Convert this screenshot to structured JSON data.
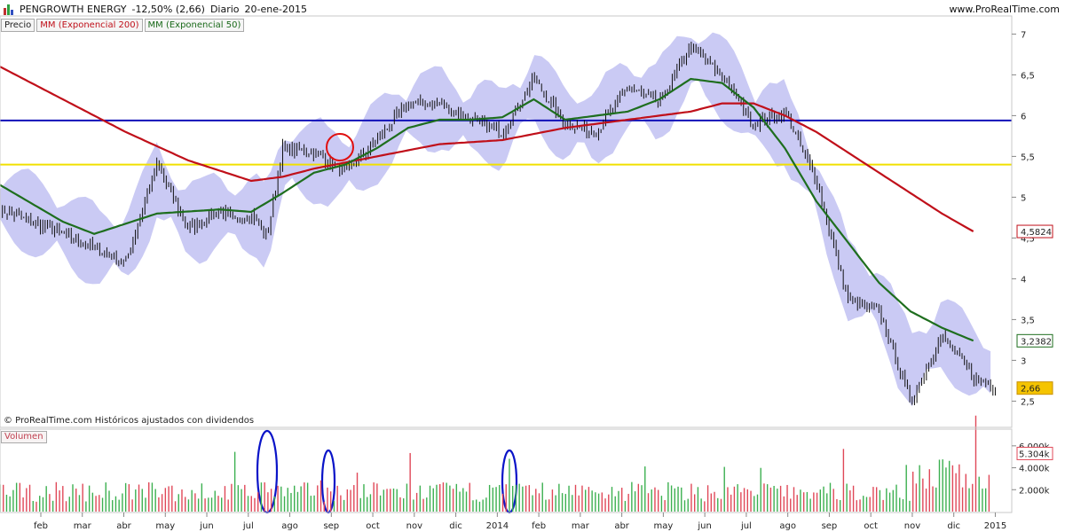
{
  "header": {
    "symbol": "PENGROWTH ENERGY",
    "change": "-12,50% (2,66)",
    "period": "Diario",
    "date": "20-ene-2015",
    "site": "www.ProRealTime.com"
  },
  "legend": {
    "price": "Precio",
    "ma200": "MM (Exponencial 200)",
    "ma50": "MM (Exponencial 50)"
  },
  "copyright": "© ProRealTime.com  Históricos ajustados con dividendos",
  "volume_label": "Volumen",
  "colors": {
    "ma200": "#c0101a",
    "ma50": "#1e6e1e",
    "band": "#b8b8f0",
    "blue_line": "#1010b8",
    "yellow_line": "#f0e000",
    "vol_up": "#3cb050",
    "vol_down": "#e04858",
    "highlight_circle_red": "#e01010",
    "highlight_ellipse_blue": "#0a14c8"
  },
  "price_labels": {
    "ma200": "4,5824",
    "ma50": "3,2382",
    "last": "2,66",
    "volume_last": "5.304k"
  },
  "chart_data": {
    "type": "line",
    "price_axis": {
      "ticks": [
        "7",
        "6,5",
        "6",
        "5,5",
        "5",
        "4,5",
        "4",
        "3,5",
        "3",
        "2,5"
      ],
      "values": [
        7,
        6.5,
        6,
        5.5,
        5,
        4.5,
        4,
        3.5,
        3,
        2.5
      ],
      "range": [
        2.2,
        7.2
      ]
    },
    "volume_axis": {
      "ticks": [
        "6.000k",
        "4.000k",
        "2.000k"
      ],
      "values": [
        6000,
        4000,
        2000
      ],
      "range": [
        0,
        7200
      ]
    },
    "x_ticks": [
      "feb",
      "mar",
      "abr",
      "may",
      "jun",
      "jul",
      "ago",
      "sep",
      "oct",
      "nov",
      "dic",
      "2014",
      "feb",
      "mar",
      "abr",
      "may",
      "jun",
      "jul",
      "ago",
      "sep",
      "oct",
      "nov",
      "dic",
      "2015"
    ],
    "horizontal_lines": [
      {
        "name": "resistance",
        "value": 5.94
      },
      {
        "name": "support",
        "value": 5.4
      }
    ],
    "price_series": {
      "name": "Precio",
      "t": [
        0,
        2,
        4,
        5,
        6,
        7,
        7.5,
        8,
        8.5,
        9,
        10,
        11,
        12,
        13,
        14,
        15,
        16,
        17,
        18,
        19,
        20,
        21,
        22,
        23,
        24,
        25,
        26,
        27,
        28,
        29,
        30,
        31,
        31.7
      ],
      "values": [
        4.85,
        4.55,
        4.2,
        5.4,
        4.6,
        4.85,
        4.7,
        4.8,
        4.5,
        5.6,
        5.55,
        5.3,
        5.7,
        6.15,
        6.15,
        5.95,
        5.8,
        6.45,
        5.9,
        5.8,
        6.35,
        6.15,
        6.85,
        6.5,
        5.9,
        6.05,
        5.2,
        3.75,
        3.6,
        2.5,
        3.3,
        2.8,
        2.66
      ]
    },
    "ma50_series": {
      "name": "MM (Exponencial 50)",
      "t": [
        0,
        2,
        3,
        5,
        7,
        8,
        9,
        10,
        11,
        12,
        13,
        14,
        15,
        16,
        17,
        18,
        19,
        20,
        21,
        22,
        23,
        24,
        25,
        26,
        27,
        28,
        29,
        30,
        31
      ],
      "values": [
        5.15,
        4.7,
        4.55,
        4.8,
        4.85,
        4.82,
        5.05,
        5.3,
        5.4,
        5.6,
        5.85,
        5.95,
        5.95,
        5.98,
        6.2,
        5.95,
        6.0,
        6.05,
        6.2,
        6.45,
        6.4,
        6.1,
        5.6,
        4.95,
        4.45,
        3.95,
        3.6,
        3.4,
        3.24
      ]
    },
    "ma200_series": {
      "name": "MM (Exponencial 200)",
      "t": [
        0,
        2,
        4,
        6,
        8,
        9,
        10,
        12,
        14,
        16,
        18,
        20,
        22,
        23,
        24,
        25,
        26,
        27,
        28,
        29,
        30,
        31
      ],
      "values": [
        6.6,
        6.2,
        5.8,
        5.45,
        5.2,
        5.25,
        5.35,
        5.5,
        5.65,
        5.7,
        5.85,
        5.95,
        6.05,
        6.15,
        6.15,
        6.0,
        5.8,
        5.55,
        5.3,
        5.05,
        4.8,
        4.58
      ]
    },
    "volume_series": {
      "name": "Volumen",
      "last": 5304
    }
  }
}
